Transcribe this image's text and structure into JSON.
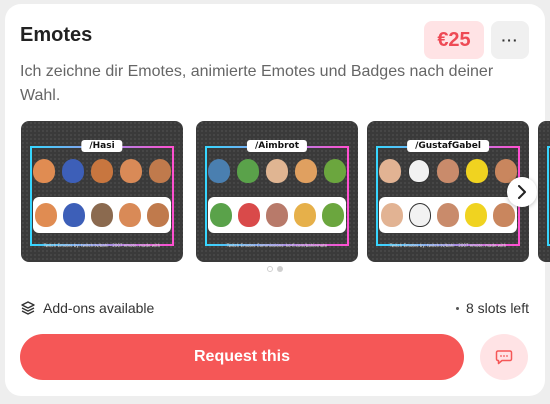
{
  "offer": {
    "title": "Emotes",
    "price": "€25",
    "more_label": "···",
    "description": "Ich zeichne dir Emotes, animierte Emotes und Badges nach deiner Wahl."
  },
  "gallery": {
    "thumbnails": [
      {
        "tag": "/Hasi",
        "footer": "Twitch Emotes by: twitch.tv/bahi · 2007 emote, made with"
      },
      {
        "tag": "/Aimbrot",
        "footer": "Twitch Emotes Commissions: ko-fi.com/bahiemote"
      },
      {
        "tag": "/GustafGabel",
        "footer": "Twitch Emotes by: twitch.tv/bahi · 2007 emote, made with"
      }
    ],
    "next_icon": "chevron-right-icon",
    "page_count": 2,
    "active_page": 1
  },
  "meta": {
    "addons_label": "Add-ons available",
    "addons_icon": "layers-icon",
    "slots_label": "8 slots left"
  },
  "actions": {
    "request_label": "Request this",
    "chat_icon": "chat-bubble-icon"
  },
  "colors": {
    "accent": "#f55757",
    "price_bg": "#ffe3e5",
    "price_text": "#ee4a55"
  }
}
